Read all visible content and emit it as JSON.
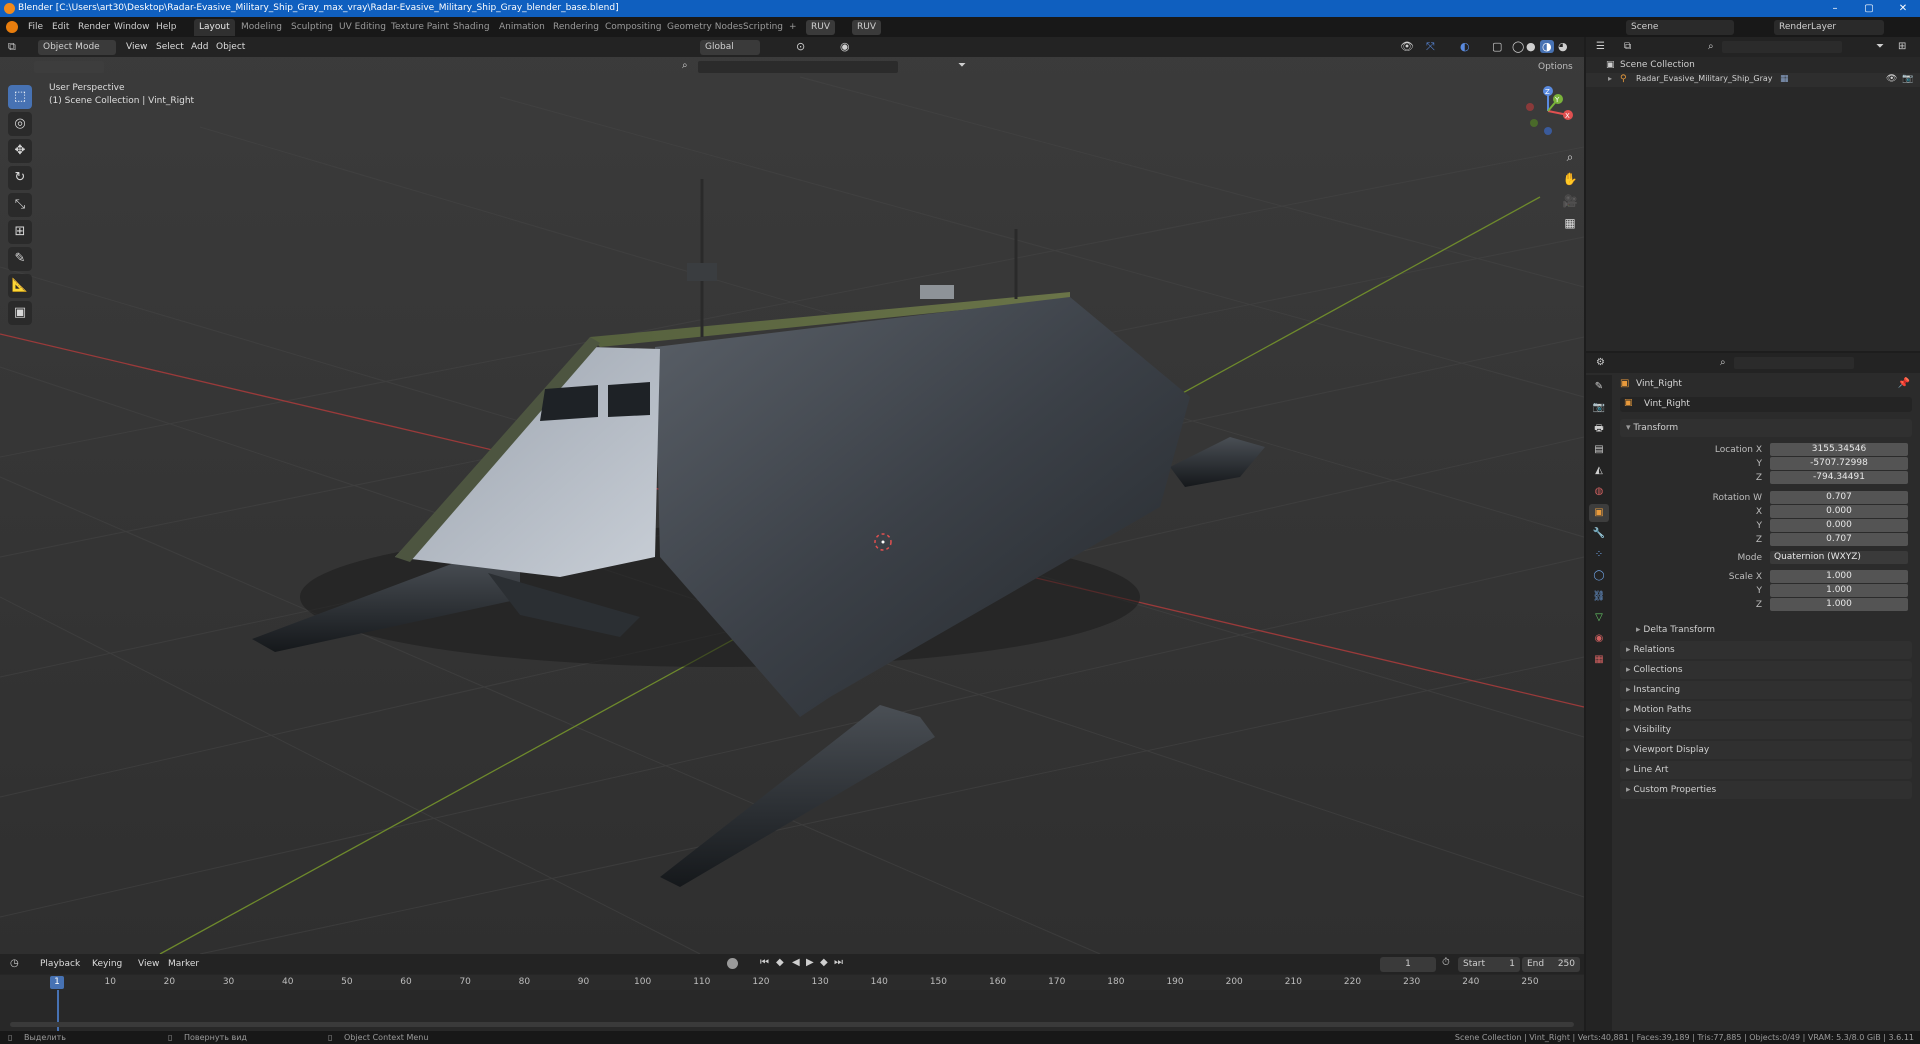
{
  "window": {
    "title": "Blender [C:\\Users\\art30\\Desktop\\Radar-Evasive_Military_Ship_Gray_max_vray\\Radar-Evasive_Military_Ship_Gray_blender_base.blend]",
    "minimize": "–",
    "maximize": "▢",
    "close": "✕"
  },
  "menu": [
    "File",
    "Edit",
    "Render",
    "Window",
    "Help"
  ],
  "workspaces": [
    "Layout",
    "Modeling",
    "Sculpting",
    "UV Editing",
    "Texture Paint",
    "Shading",
    "Animation",
    "Rendering",
    "Compositing",
    "Geometry Nodes",
    "Scripting"
  ],
  "workspace_active": "Layout",
  "workspace_add": "+",
  "addon_buttons": [
    "RUV",
    "RUV"
  ],
  "scene": {
    "label": "Scene",
    "render_layer": "RenderLayer"
  },
  "viewport": {
    "mode": "Object Mode",
    "menus": [
      "View",
      "Select",
      "Add",
      "Object"
    ],
    "transform_orientation": "Global",
    "options": "Options",
    "perspective_label": "User Perspective",
    "collection_label": "(1) Scene Collection | Vint_Right"
  },
  "tools": [
    {
      "name": "select-box-tool",
      "glyph": "⬚",
      "active": true
    },
    {
      "name": "cursor-tool",
      "glyph": "◎",
      "active": false
    },
    {
      "name": "move-tool",
      "glyph": "✥",
      "active": false
    },
    {
      "name": "rotate-tool",
      "glyph": "↻",
      "active": false
    },
    {
      "name": "scale-tool",
      "glyph": "⤡",
      "active": false
    },
    {
      "name": "transform-tool",
      "glyph": "⊞",
      "active": false
    },
    {
      "name": "annotate-tool",
      "glyph": "✎",
      "active": false
    },
    {
      "name": "measure-tool",
      "glyph": "📐",
      "active": false
    },
    {
      "name": "add-cube-tool",
      "glyph": "▣",
      "active": false
    }
  ],
  "gizmo": {
    "x": "X",
    "y": "Y",
    "z": "Z"
  },
  "nav_buttons": [
    {
      "name": "zoom-icon",
      "glyph": "⌕"
    },
    {
      "name": "pan-hand-icon",
      "glyph": "✋"
    },
    {
      "name": "camera-view-icon",
      "glyph": "🎥"
    },
    {
      "name": "ortho-grid-icon",
      "glyph": "▦"
    }
  ],
  "outliner": {
    "root": "Scene Collection",
    "items": [
      {
        "label": "Radar_Evasive_Military_Ship_Gray"
      }
    ]
  },
  "properties": {
    "object_name": "Vint_Right",
    "data_name": "Vint_Right",
    "transform_header": "Transform",
    "location": {
      "label": "Location X",
      "x": "3155.34546",
      "y": "-5707.72998",
      "z": "-794.34491"
    },
    "rotation": {
      "label": "Rotation W",
      "w": "0.707",
      "x": "0.000",
      "y": "0.000",
      "z": "0.707"
    },
    "mode_label": "Mode",
    "mode_value": "Quaternion (WXYZ)",
    "scale": {
      "label": "Scale X",
      "x": "1.000",
      "y": "1.000",
      "z": "1.000"
    },
    "axis_labels": {
      "y": "Y",
      "z": "Z",
      "x": "X"
    },
    "panels": [
      "Delta Transform",
      "Relations",
      "Collections",
      "Instancing",
      "Motion Paths",
      "Visibility",
      "Viewport Display",
      "Line Art",
      "Custom Properties"
    ]
  },
  "timeline": {
    "menus": [
      "Playback",
      "Keying",
      "View",
      "Marker"
    ],
    "current_frame": "1",
    "start_label": "Start",
    "start": "1",
    "end_label": "End",
    "end": "250",
    "ticks": [
      "1",
      "10",
      "20",
      "30",
      "40",
      "50",
      "60",
      "70",
      "80",
      "90",
      "100",
      "110",
      "120",
      "130",
      "140",
      "150",
      "160",
      "170",
      "180",
      "190",
      "200",
      "210",
      "220",
      "230",
      "240",
      "250"
    ]
  },
  "status": {
    "select": "Выделить",
    "rotate": "Повернуть вид",
    "context": "Object Context Menu",
    "stats": "Scene Collection | Vint_Right | Verts:40,881 | Faces:39,189 | Tris:77,885 | Objects:0/49 | VRAM: 5.3/8.0 GiB | 3.6.11"
  }
}
